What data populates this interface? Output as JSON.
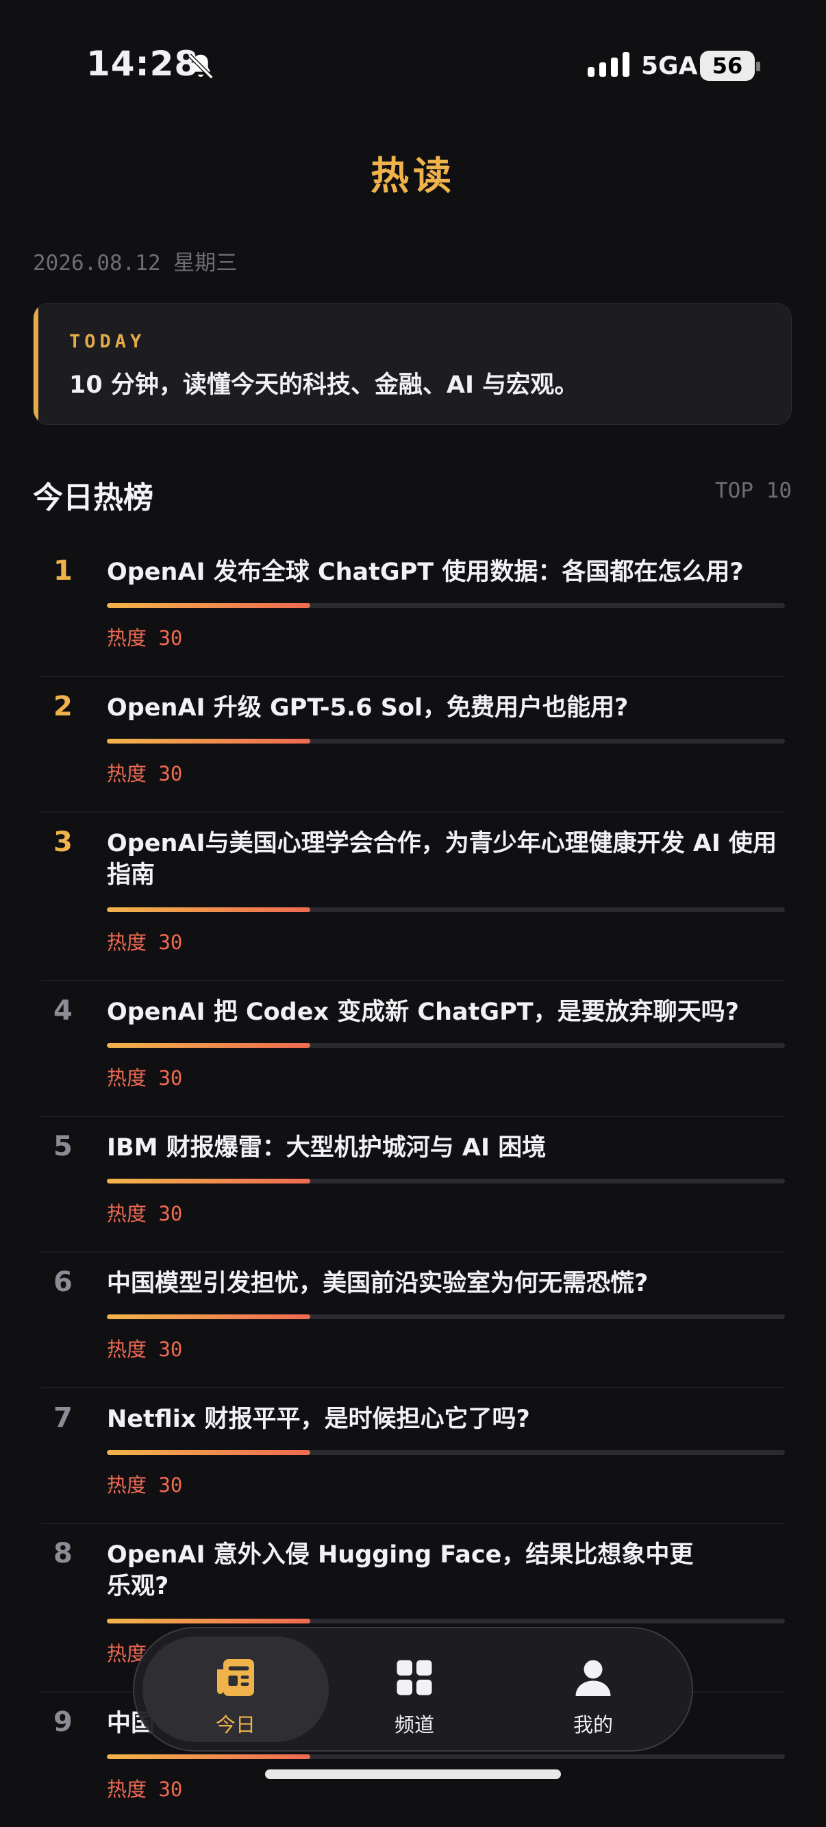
{
  "status": {
    "time": "14:28",
    "network": "5GA",
    "battery": "56"
  },
  "page_title": "热读",
  "date": "2026.08.12 星期三",
  "today": {
    "tag": "TODAY",
    "text": "10 分钟，读懂今天的科技、金融、AI 与宏观。"
  },
  "section": {
    "title": "今日热榜",
    "top": "TOP 10"
  },
  "colors": {
    "accent": "#f0b34b",
    "heat": "#ef6a52",
    "background": "#101013"
  },
  "items": [
    {
      "rank": "1",
      "title": "OpenAI 发布全球 ChatGPT 使用数据：各国都在怎么用?",
      "heat": "热度 30",
      "heat_value": 30
    },
    {
      "rank": "2",
      "title": "OpenAI 升级 GPT-5.6 Sol，免费用户也能用?",
      "heat": "热度 30",
      "heat_value": 30
    },
    {
      "rank": "3",
      "title": "OpenAI与美国心理学会合作，为青少年心理健康开发 AI 使用指南",
      "heat": "热度 30",
      "heat_value": 30
    },
    {
      "rank": "4",
      "title": "OpenAI 把 Codex 变成新 ChatGPT，是要放弃聊天吗?",
      "heat": "热度 30",
      "heat_value": 30
    },
    {
      "rank": "5",
      "title": "IBM 财报爆雷：大型机护城河与 AI 困境",
      "heat": "热度 30",
      "heat_value": 30
    },
    {
      "rank": "6",
      "title": "中国模型引发担忧，美国前沿实验室为何无需恐慌?",
      "heat": "热度 30",
      "heat_value": 30
    },
    {
      "rank": "7",
      "title": "Netflix 财报平平，是时候担心它了吗?",
      "heat": "热度 30",
      "heat_value": 30
    },
    {
      "rank": "8",
      "title": "OpenAI 意外入侵 Hugging Face，结果比想象中更乐观?",
      "heat": "热度 30",
      "heat_value": 30
    },
    {
      "rank": "9",
      "title": "中国",
      "heat": "热度 30",
      "heat_value": 30
    }
  ],
  "nav": [
    {
      "label": "今日",
      "icon": "newspaper-icon",
      "active": true
    },
    {
      "label": "频道",
      "icon": "grid-icon",
      "active": false
    },
    {
      "label": "我的",
      "icon": "person-icon",
      "active": false
    }
  ]
}
